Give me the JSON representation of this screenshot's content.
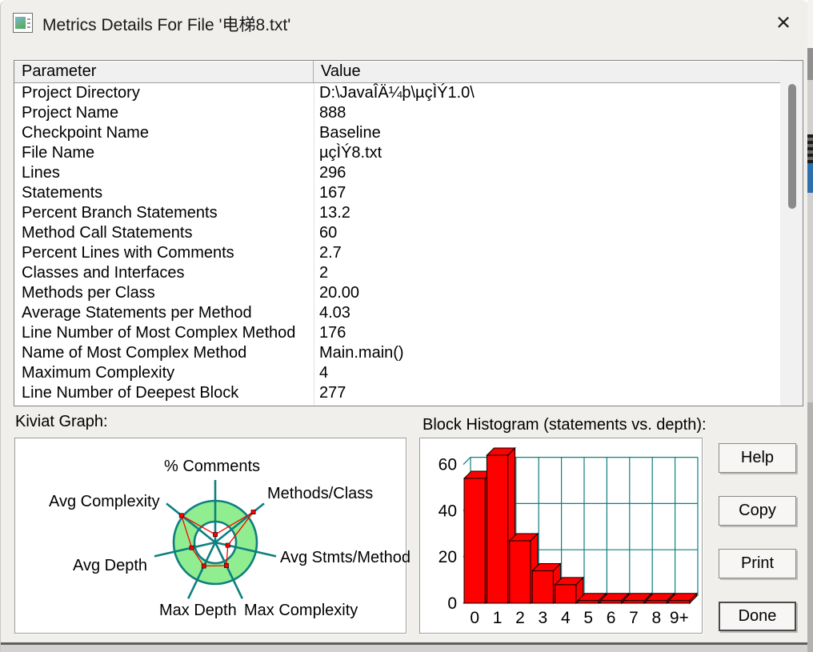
{
  "window": {
    "title": "Metrics Details For File '电梯8.txt'",
    "close_glyph": "×",
    "icon": "sourcemonitor-app-icon"
  },
  "table": {
    "columns": [
      "Parameter",
      "Value"
    ],
    "rows": [
      {
        "parameter": "Project Directory",
        "value": "D:\\JavaÎÄ¼þ\\µçÌÝ1.0\\"
      },
      {
        "parameter": "Project Name",
        "value": "888"
      },
      {
        "parameter": "Checkpoint Name",
        "value": "Baseline"
      },
      {
        "parameter": "File Name",
        "value": "µçÌÝ8.txt"
      },
      {
        "parameter": "Lines",
        "value": "296"
      },
      {
        "parameter": "Statements",
        "value": "167"
      },
      {
        "parameter": "Percent Branch Statements",
        "value": "13.2"
      },
      {
        "parameter": "Method Call Statements",
        "value": "60"
      },
      {
        "parameter": "Percent Lines with Comments",
        "value": "2.7"
      },
      {
        "parameter": "Classes and Interfaces",
        "value": "2"
      },
      {
        "parameter": "Methods per Class",
        "value": "20.00"
      },
      {
        "parameter": "Average Statements per Method",
        "value": "4.03"
      },
      {
        "parameter": "Line Number of Most Complex Method",
        "value": "176"
      },
      {
        "parameter": "Name of Most Complex Method",
        "value": "Main.main()"
      },
      {
        "parameter": "Maximum Complexity",
        "value": "4"
      },
      {
        "parameter": "Line Number of Deepest Block",
        "value": "277"
      }
    ]
  },
  "kiviat": {
    "section_label": "Kiviat Graph:"
  },
  "histogram": {
    "section_label": "Block Histogram (statements vs. depth):"
  },
  "buttons": [
    "Help",
    "Copy",
    "Print",
    "Done"
  ],
  "chart_data": [
    {
      "type": "radar",
      "title": "Kiviat Graph",
      "axes": [
        "% Comments",
        "Methods/Class",
        "Avg Stmts/Method",
        "Max Complexity",
        "Max Depth",
        "Avg Depth",
        "Avg Complexity"
      ],
      "values_norm": [
        0.19,
        1.17,
        0.31,
        0.62,
        0.63,
        0.58,
        1.04
      ],
      "inner_ring_norm": 0.5,
      "outer_ring_norm": 1.0,
      "ring_fill_color": "#90EE90",
      "axis_color": "#0e7f7f",
      "series_color": "#ff0000",
      "note": "green annulus spans acceptable range between inner and outer circles; red polygon = file metrics"
    },
    {
      "type": "bar",
      "title": "Block Histogram (statements vs. depth)",
      "categories": [
        "0",
        "1",
        "2",
        "3",
        "4",
        "5",
        "6",
        "7",
        "8",
        "9+"
      ],
      "values": [
        54,
        64,
        27,
        14,
        8,
        0,
        0,
        0,
        0,
        0
      ],
      "xlabel": "depth",
      "ylabel": "statements",
      "yticks": [
        0,
        20,
        40,
        60
      ],
      "ylim": [
        0,
        69
      ],
      "bar_color": "#ff0000",
      "grid_color": "#0e7f7f",
      "grid": "on",
      "style": "3d"
    }
  ],
  "colors": {
    "dialog_bg": "#f1efec",
    "accent_teal": "#0e7f7f",
    "accent_green": "#90EE90",
    "accent_red": "#ff0000",
    "sliver_blue": "#2e6fae"
  }
}
